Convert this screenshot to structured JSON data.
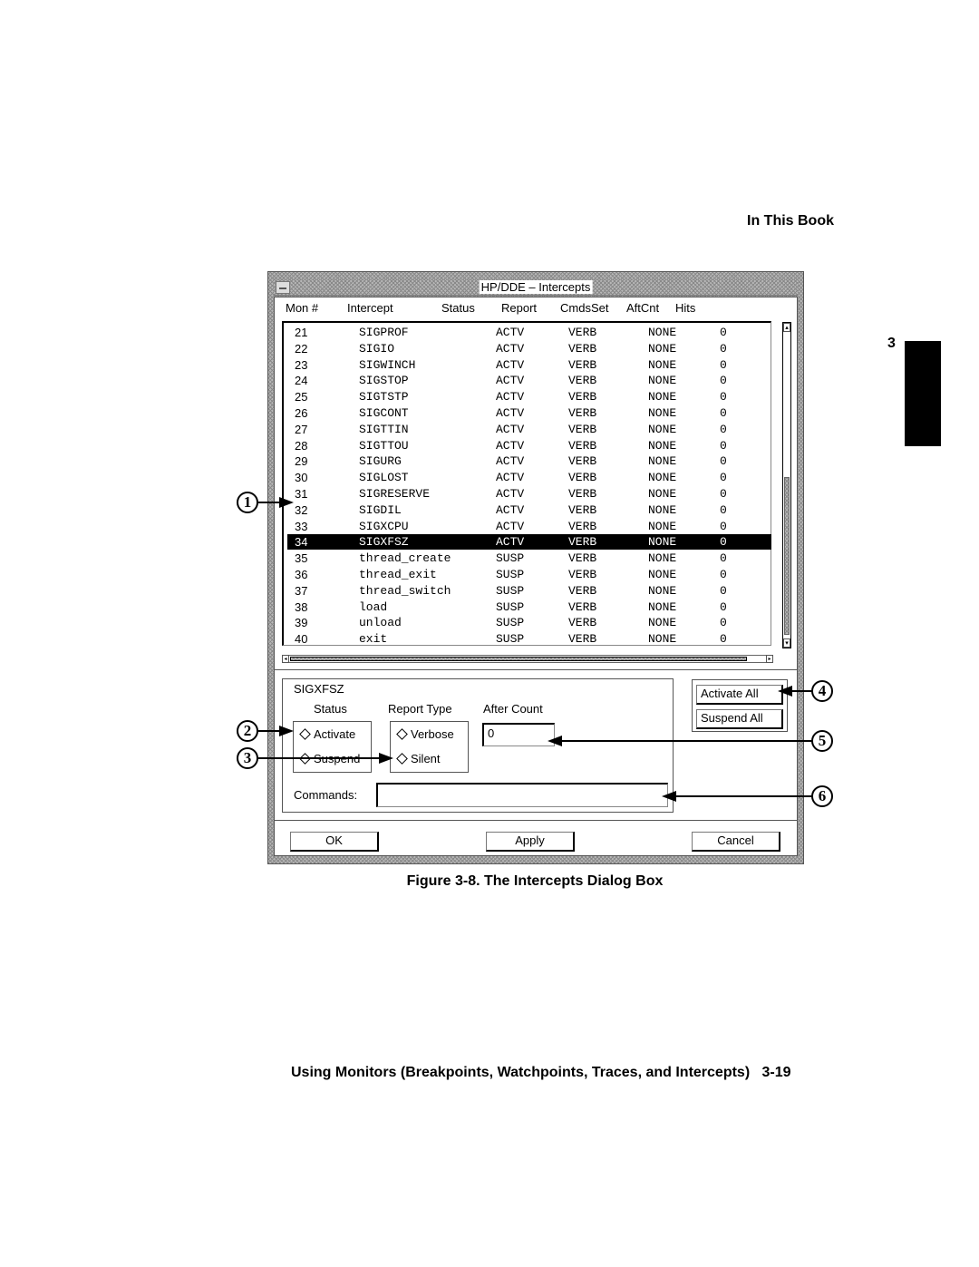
{
  "page": {
    "running_header": "In This Book",
    "chapter_tab_number": "3",
    "figure_caption": "Figure 3-8. The Intercepts Dialog Box",
    "footer_title": "Using Monitors (Breakpoints, Watchpoints, Traces, and Intercepts)",
    "footer_page": "3-19"
  },
  "dialog": {
    "title": "HP/DDE – Intercepts",
    "window_menu_icon": "window-menu-icon",
    "columns": [
      "Mon #",
      "Intercept",
      "Status",
      "Report",
      "CmdsSet",
      "AftCnt",
      "Hits"
    ],
    "selected_row": "34",
    "rows": [
      {
        "mon": "21",
        "intercept": "SIGPROF",
        "report": "ACTV",
        "cmds": "VERB",
        "aft": "NONE",
        "hits": "0"
      },
      {
        "mon": "22",
        "intercept": "SIGIO",
        "report": "ACTV",
        "cmds": "VERB",
        "aft": "NONE",
        "hits": "0"
      },
      {
        "mon": "23",
        "intercept": "SIGWINCH",
        "report": "ACTV",
        "cmds": "VERB",
        "aft": "NONE",
        "hits": "0"
      },
      {
        "mon": "24",
        "intercept": "SIGSTOP",
        "report": "ACTV",
        "cmds": "VERB",
        "aft": "NONE",
        "hits": "0"
      },
      {
        "mon": "25",
        "intercept": "SIGTSTP",
        "report": "ACTV",
        "cmds": "VERB",
        "aft": "NONE",
        "hits": "0"
      },
      {
        "mon": "26",
        "intercept": "SIGCONT",
        "report": "ACTV",
        "cmds": "VERB",
        "aft": "NONE",
        "hits": "0"
      },
      {
        "mon": "27",
        "intercept": "SIGTTIN",
        "report": "ACTV",
        "cmds": "VERB",
        "aft": "NONE",
        "hits": "0"
      },
      {
        "mon": "28",
        "intercept": "SIGTTOU",
        "report": "ACTV",
        "cmds": "VERB",
        "aft": "NONE",
        "hits": "0"
      },
      {
        "mon": "29",
        "intercept": "SIGURG",
        "report": "ACTV",
        "cmds": "VERB",
        "aft": "NONE",
        "hits": "0"
      },
      {
        "mon": "30",
        "intercept": "SIGLOST",
        "report": "ACTV",
        "cmds": "VERB",
        "aft": "NONE",
        "hits": "0"
      },
      {
        "mon": "31",
        "intercept": "SIGRESERVE",
        "report": "ACTV",
        "cmds": "VERB",
        "aft": "NONE",
        "hits": "0"
      },
      {
        "mon": "32",
        "intercept": "SIGDIL",
        "report": "ACTV",
        "cmds": "VERB",
        "aft": "NONE",
        "hits": "0"
      },
      {
        "mon": "33",
        "intercept": "SIGXCPU",
        "report": "ACTV",
        "cmds": "VERB",
        "aft": "NONE",
        "hits": "0"
      },
      {
        "mon": "34",
        "intercept": "SIGXFSZ",
        "report": "ACTV",
        "cmds": "VERB",
        "aft": "NONE",
        "hits": "0"
      },
      {
        "mon": "35",
        "intercept": "thread_create",
        "report": "SUSP",
        "cmds": "VERB",
        "aft": "NONE",
        "hits": "0"
      },
      {
        "mon": "36",
        "intercept": "thread_exit",
        "report": "SUSP",
        "cmds": "VERB",
        "aft": "NONE",
        "hits": "0"
      },
      {
        "mon": "37",
        "intercept": "thread_switch",
        "report": "SUSP",
        "cmds": "VERB",
        "aft": "NONE",
        "hits": "0"
      },
      {
        "mon": "38",
        "intercept": "load",
        "report": "SUSP",
        "cmds": "VERB",
        "aft": "NONE",
        "hits": "0"
      },
      {
        "mon": "39",
        "intercept": "unload",
        "report": "SUSP",
        "cmds": "VERB",
        "aft": "NONE",
        "hits": "0"
      },
      {
        "mon": "40",
        "intercept": "exit",
        "report": "SUSP",
        "cmds": "VERB",
        "aft": "NONE",
        "hits": "0"
      }
    ],
    "scroll_up_glyph": "▴",
    "scroll_down_glyph": "▾",
    "scroll_left_glyph": "◂",
    "scroll_right_glyph": "▸",
    "vertical_scroll_position": 0.55,
    "detail": {
      "selected_name": "SIGXFSZ",
      "status_label": "Status",
      "status_options": [
        "Activate",
        "Suspend"
      ],
      "report_type_label": "Report Type",
      "report_options": [
        "Verbose",
        "Silent"
      ],
      "after_count_label": "After Count",
      "after_count_value": "0",
      "commands_label": "Commands:",
      "commands_value": ""
    },
    "buttons": {
      "activate_all": "Activate All",
      "suspend_all": "Suspend All",
      "ok": "OK",
      "apply": "Apply",
      "cancel": "Cancel"
    }
  },
  "callouts": [
    "1",
    "2",
    "3",
    "4",
    "5",
    "6"
  ]
}
